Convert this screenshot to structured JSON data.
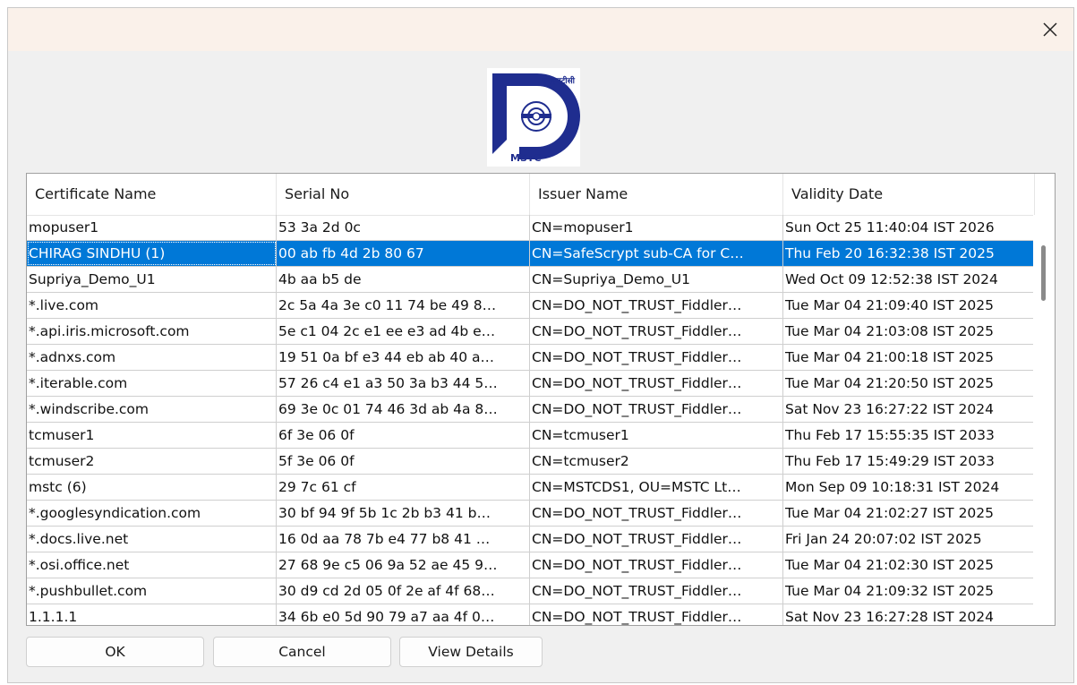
{
  "window": {
    "close_icon": "close-icon"
  },
  "logo": {
    "top_text": "एमएसटीसी",
    "brand_text": "MSTC",
    "icon": "mstc-logo"
  },
  "table": {
    "columns": [
      "Certificate Name",
      "Serial No",
      "Issuer Name",
      "Validity Date"
    ],
    "selected_index": 1,
    "rows": [
      {
        "name": "mopuser1",
        "serial": "53 3a 2d 0c",
        "issuer": "CN=mopuser1",
        "validity": "Sun Oct 25 11:40:04 IST 2026"
      },
      {
        "name": "CHIRAG SINDHU (1)",
        "serial": "00 ab fb 4d 2b 80 67",
        "issuer": "CN=SafeScrypt sub-CA for C…",
        "validity": "Thu Feb 20 16:32:38 IST 2025"
      },
      {
        "name": "Supriya_Demo_U1",
        "serial": "4b aa b5 de",
        "issuer": "CN=Supriya_Demo_U1",
        "validity": "Wed Oct 09 12:52:38 IST 2024"
      },
      {
        "name": "*.live.com",
        "serial": "2c 5a 4a 3e c0 11 74 be 49 8…",
        "issuer": "CN=DO_NOT_TRUST_Fiddler…",
        "validity": "Tue Mar 04 21:09:40 IST 2025"
      },
      {
        "name": "*.api.iris.microsoft.com",
        "serial": "5e c1 04 2c e1 ee e3 ad 4b e…",
        "issuer": "CN=DO_NOT_TRUST_Fiddler…",
        "validity": "Tue Mar 04 21:03:08 IST 2025"
      },
      {
        "name": "*.adnxs.com",
        "serial": "19 51 0a bf e3 44 eb ab 40 a…",
        "issuer": "CN=DO_NOT_TRUST_Fiddler…",
        "validity": "Tue Mar 04 21:00:18 IST 2025"
      },
      {
        "name": "*.iterable.com",
        "serial": "57 26 c4 e1 a3 50 3a b3 44 5…",
        "issuer": "CN=DO_NOT_TRUST_Fiddler…",
        "validity": "Tue Mar 04 21:20:50 IST 2025"
      },
      {
        "name": "*.windscribe.com",
        "serial": "69 3e 0c 01 74 46 3d ab 4a 8…",
        "issuer": "CN=DO_NOT_TRUST_Fiddler…",
        "validity": "Sat Nov 23 16:27:22 IST 2024"
      },
      {
        "name": "tcmuser1",
        "serial": "6f 3e 06 0f",
        "issuer": "CN=tcmuser1",
        "validity": "Thu Feb 17 15:55:35 IST 2033"
      },
      {
        "name": "tcmuser2",
        "serial": "5f 3e 06 0f",
        "issuer": "CN=tcmuser2",
        "validity": "Thu Feb 17 15:49:29 IST 2033"
      },
      {
        "name": "mstc (6)",
        "serial": "29 7c 61 cf",
        "issuer": "CN=MSTCDS1, OU=MSTC Lt…",
        "validity": "Mon Sep 09 10:18:31 IST 2024"
      },
      {
        "name": "*.googlesyndication.com",
        "serial": "30 bf 94 9f 5b 1c 2b b3 41 b…",
        "issuer": "CN=DO_NOT_TRUST_Fiddler…",
        "validity": "Tue Mar 04 21:02:27 IST 2025"
      },
      {
        "name": "*.docs.live.net",
        "serial": "16 0d aa 78 7b e4 77 b8 41 …",
        "issuer": "CN=DO_NOT_TRUST_Fiddler…",
        "validity": "Fri Jan 24 20:07:02 IST 2025"
      },
      {
        "name": "*.osi.office.net",
        "serial": "27 68 9e c5 06 9a 52 ae 45 9…",
        "issuer": "CN=DO_NOT_TRUST_Fiddler…",
        "validity": "Tue Mar 04 21:02:30 IST 2025"
      },
      {
        "name": "*.pushbullet.com",
        "serial": "30 d9 cd 2d 05 0f 2e af 4f 68…",
        "issuer": "CN=DO_NOT_TRUST_Fiddler…",
        "validity": "Tue Mar 04 21:09:32 IST 2025"
      },
      {
        "name": "1.1.1.1",
        "serial": "34 6b e0 5d 90 79 a7 aa 4f 0…",
        "issuer": "CN=DO_NOT_TRUST_Fiddler…",
        "validity": "Sat Nov 23 16:27:28 IST 2024"
      }
    ]
  },
  "buttons": {
    "ok": "OK",
    "cancel": "Cancel",
    "view_details": "View Details"
  },
  "colors": {
    "selection": "#0078d7",
    "logo_blue": "#1f2d8f"
  }
}
